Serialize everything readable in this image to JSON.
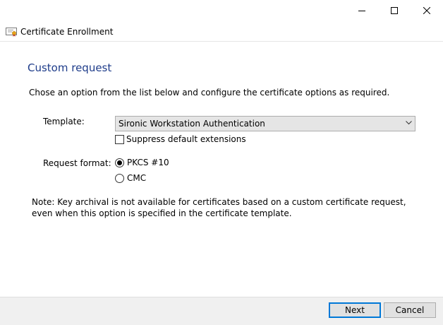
{
  "window": {
    "title": "Certificate Enrollment"
  },
  "page": {
    "heading": "Custom request",
    "intro": "Chose an option from the list below and configure the certificate options as required."
  },
  "template": {
    "label": "Template:",
    "selected": "Sironic Workstation Authentication",
    "suppress_label": "Suppress default extensions",
    "suppress_checked": false
  },
  "request_format": {
    "label": "Request format:",
    "options": [
      {
        "label": "PKCS #10",
        "selected": true
      },
      {
        "label": "CMC",
        "selected": false
      }
    ]
  },
  "note": "Note: Key archival is not available for certificates based on a custom certificate request, even when this option is specified in the certificate template.",
  "buttons": {
    "next": "Next",
    "cancel": "Cancel"
  },
  "icons": {
    "app": "certificate-icon",
    "minimize": "minimize-icon",
    "maximize": "maximize-icon",
    "close": "close-icon",
    "dropdown": "chevron-down-icon"
  },
  "colors": {
    "heading": "#1e3c8a",
    "accent": "#0078d7"
  }
}
